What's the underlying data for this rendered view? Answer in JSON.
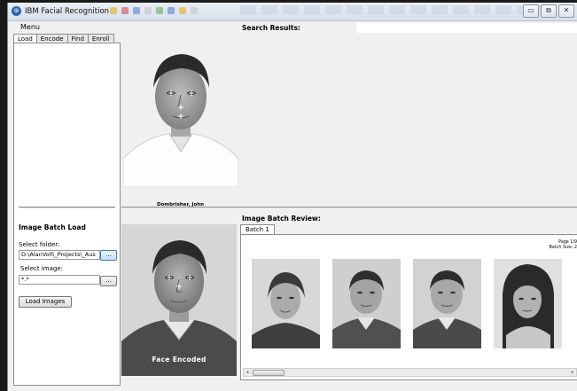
{
  "window": {
    "title": "IBM Facial Recognition",
    "minimize": "▭",
    "restore": "⧉",
    "close": "✕"
  },
  "menu": {
    "label": "Menu"
  },
  "tabs": [
    {
      "label": "Load"
    },
    {
      "label": "Encode"
    },
    {
      "label": "Find"
    },
    {
      "label": "Enroll"
    }
  ],
  "batch_load": {
    "heading": "Image Batch Load",
    "folder_label": "Select folder:",
    "folder_value": "D:\\AlanVoll\\_Projects\\_Aus",
    "browse_label": "...",
    "image_label": "Select image:",
    "image_value": "*.*",
    "browse2_label": "...",
    "load_button": "Load Images"
  },
  "probe": {
    "caption": "Dombrisher, John"
  },
  "encoded": {
    "label": "Face Encoded"
  },
  "search": {
    "heading": "Search Results:"
  },
  "batch_review": {
    "heading": "Image Batch Review:",
    "tab": "Batch 1",
    "page_line": "Page 1/9",
    "batch_size_line": "Batch Size: 2"
  },
  "scroll": {
    "left": "◂",
    "right": "▸"
  },
  "colors": {
    "accent": "#2f64b4",
    "window_bg": "#f0f0f0",
    "panel_bg": "#ffffff"
  }
}
